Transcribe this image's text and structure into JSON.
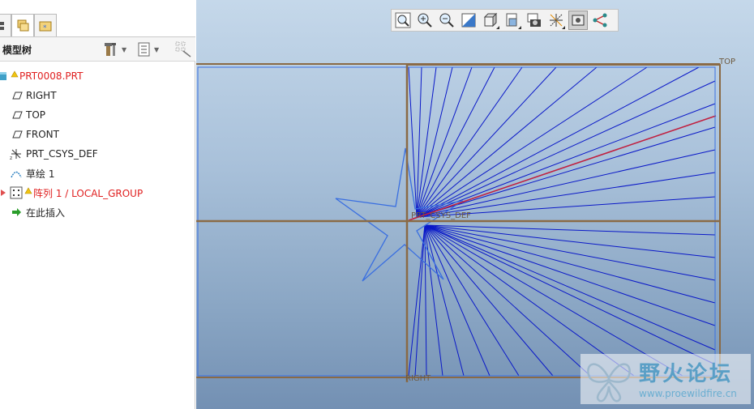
{
  "left_panel": {
    "tabs": [
      {
        "name": "model-tree-tab",
        "icon": "tree-icon"
      },
      {
        "name": "folder-browser-tab",
        "icon": "folder-stack-icon"
      },
      {
        "name": "favorites-tab",
        "icon": "star-folder-icon"
      }
    ],
    "tree_header": {
      "title": "模型树",
      "settings_icon": "hammer-icon",
      "show_icon": "list-icon",
      "filter_icon": "filter-grid-icon"
    },
    "tree_items": [
      {
        "label": "PRT0008.PRT",
        "icon": "part-icon",
        "warning": true,
        "color": "#e02020"
      },
      {
        "label": "RIGHT",
        "icon": "datum-plane-icon"
      },
      {
        "label": "TOP",
        "icon": "datum-plane-icon"
      },
      {
        "label": "FRONT",
        "icon": "datum-plane-icon"
      },
      {
        "label": "PRT_CSYS_DEF",
        "icon": "csys-icon"
      },
      {
        "label": "草绘 1",
        "icon": "sketch-icon"
      },
      {
        "label": "阵列 1 / LOCAL_GROUP",
        "icon": "pattern-icon",
        "warning": true,
        "expand": true,
        "color": "#e02020"
      },
      {
        "label": "在此插入",
        "icon": "insert-arrow-icon"
      }
    ]
  },
  "toolbar": {
    "buttons": [
      {
        "name": "refit-button",
        "icon": "zoom-fit-icon"
      },
      {
        "name": "zoom-in-button",
        "icon": "zoom-in-icon"
      },
      {
        "name": "zoom-out-button",
        "icon": "zoom-out-icon"
      },
      {
        "name": "repaint-button",
        "icon": "repaint-icon"
      },
      {
        "name": "display-style-button",
        "icon": "display-style-icon"
      },
      {
        "name": "saved-views-button",
        "icon": "saved-views-icon"
      },
      {
        "name": "view-manager-button",
        "icon": "camera-icon"
      },
      {
        "name": "datum-display-button",
        "icon": "datum-display-icon"
      },
      {
        "name": "annotation-display-button",
        "icon": "annotation-icon",
        "active": true
      },
      {
        "name": "spin-center-button",
        "icon": "spin-center-icon"
      }
    ]
  },
  "graphics": {
    "plane_labels": {
      "top": "TOP",
      "csys": "PRT_CSYS_DEF",
      "right": "RIGHT"
    },
    "colors": {
      "datum_plane": "#8a6a45",
      "sketch_lines": "#0a18c8",
      "star_outline": "#3a6fe0",
      "highlight_line": "#c02040"
    }
  },
  "watermark": {
    "title": "野火论坛",
    "url": "www.proewildfire.cn"
  }
}
